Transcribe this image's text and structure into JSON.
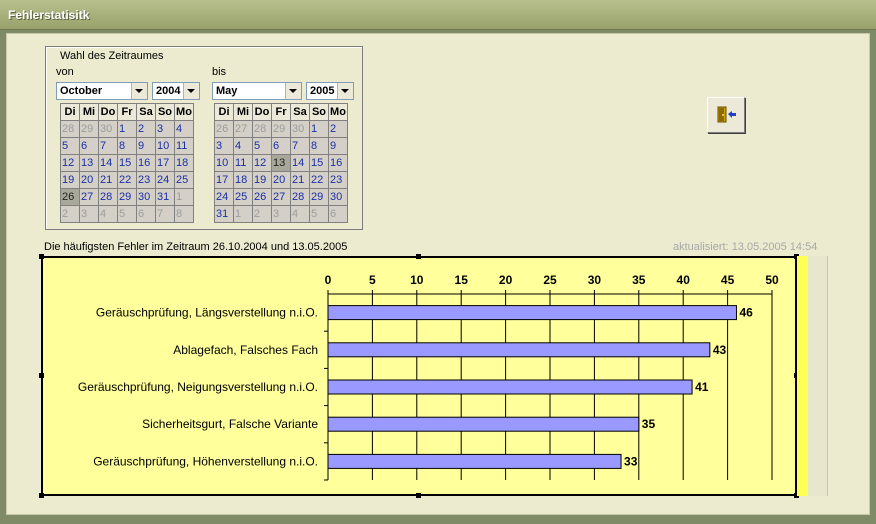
{
  "window": {
    "title": "Fehlerstatisitk"
  },
  "period": {
    "group_label": "Wahl des Zeitraumes",
    "from": {
      "label": "von",
      "month": "October",
      "year": "2004"
    },
    "to": {
      "label": "bis",
      "month": "May",
      "year": "2005"
    }
  },
  "calendar_from": {
    "headers": [
      "Di",
      "Mi",
      "Do",
      "Fr",
      "Sa",
      "So",
      "Mo"
    ],
    "rows": [
      [
        "28",
        "29",
        "30",
        "1",
        "2",
        "3",
        "4"
      ],
      [
        "5",
        "6",
        "7",
        "8",
        "9",
        "10",
        "11"
      ],
      [
        "12",
        "13",
        "14",
        "15",
        "16",
        "17",
        "18"
      ],
      [
        "19",
        "20",
        "21",
        "22",
        "23",
        "24",
        "25"
      ],
      [
        "26",
        "27",
        "28",
        "29",
        "30",
        "31",
        "1"
      ],
      [
        "2",
        "3",
        "4",
        "5",
        "6",
        "7",
        "8"
      ]
    ],
    "selected": "26"
  },
  "calendar_to": {
    "headers": [
      "Di",
      "Mi",
      "Do",
      "Fr",
      "Sa",
      "So",
      "Mo"
    ],
    "rows": [
      [
        "26",
        "27",
        "28",
        "29",
        "30",
        "1",
        "2"
      ],
      [
        "3",
        "4",
        "5",
        "6",
        "7",
        "8",
        "9"
      ],
      [
        "10",
        "11",
        "12",
        "13",
        "14",
        "15",
        "16"
      ],
      [
        "17",
        "18",
        "19",
        "20",
        "21",
        "22",
        "23"
      ],
      [
        "24",
        "25",
        "26",
        "27",
        "28",
        "29",
        "30"
      ],
      [
        "31",
        "1",
        "2",
        "3",
        "4",
        "5",
        "6"
      ]
    ],
    "selected": "13"
  },
  "chart": {
    "caption": "Die häufigsten Fehler im Zeitraum 26.10.2004 und 13.05.2005",
    "updated": "aktualisiert:  13.05.2005 14:54"
  },
  "chart_data": {
    "type": "bar",
    "orientation": "horizontal",
    "categories": [
      "Geräuschprüfung, Längsverstellung n.i.O.",
      "Ablagefach, Falsches Fach",
      "Geräuschprüfung, Neigungsverstellung n.i.O.",
      "Sicherheitsgurt, Falsche Variante",
      "Geräuschprüfung, Höhenverstellung n.i.O."
    ],
    "values": [
      46,
      43,
      41,
      35,
      33
    ],
    "xlim": [
      0,
      50
    ],
    "ticks": [
      0,
      5,
      10,
      15,
      20,
      25,
      30,
      35,
      40,
      45,
      50
    ],
    "grid": true,
    "axis_position": "top",
    "colors": {
      "bar": "#9999ff",
      "background": "#ffff9c"
    }
  }
}
